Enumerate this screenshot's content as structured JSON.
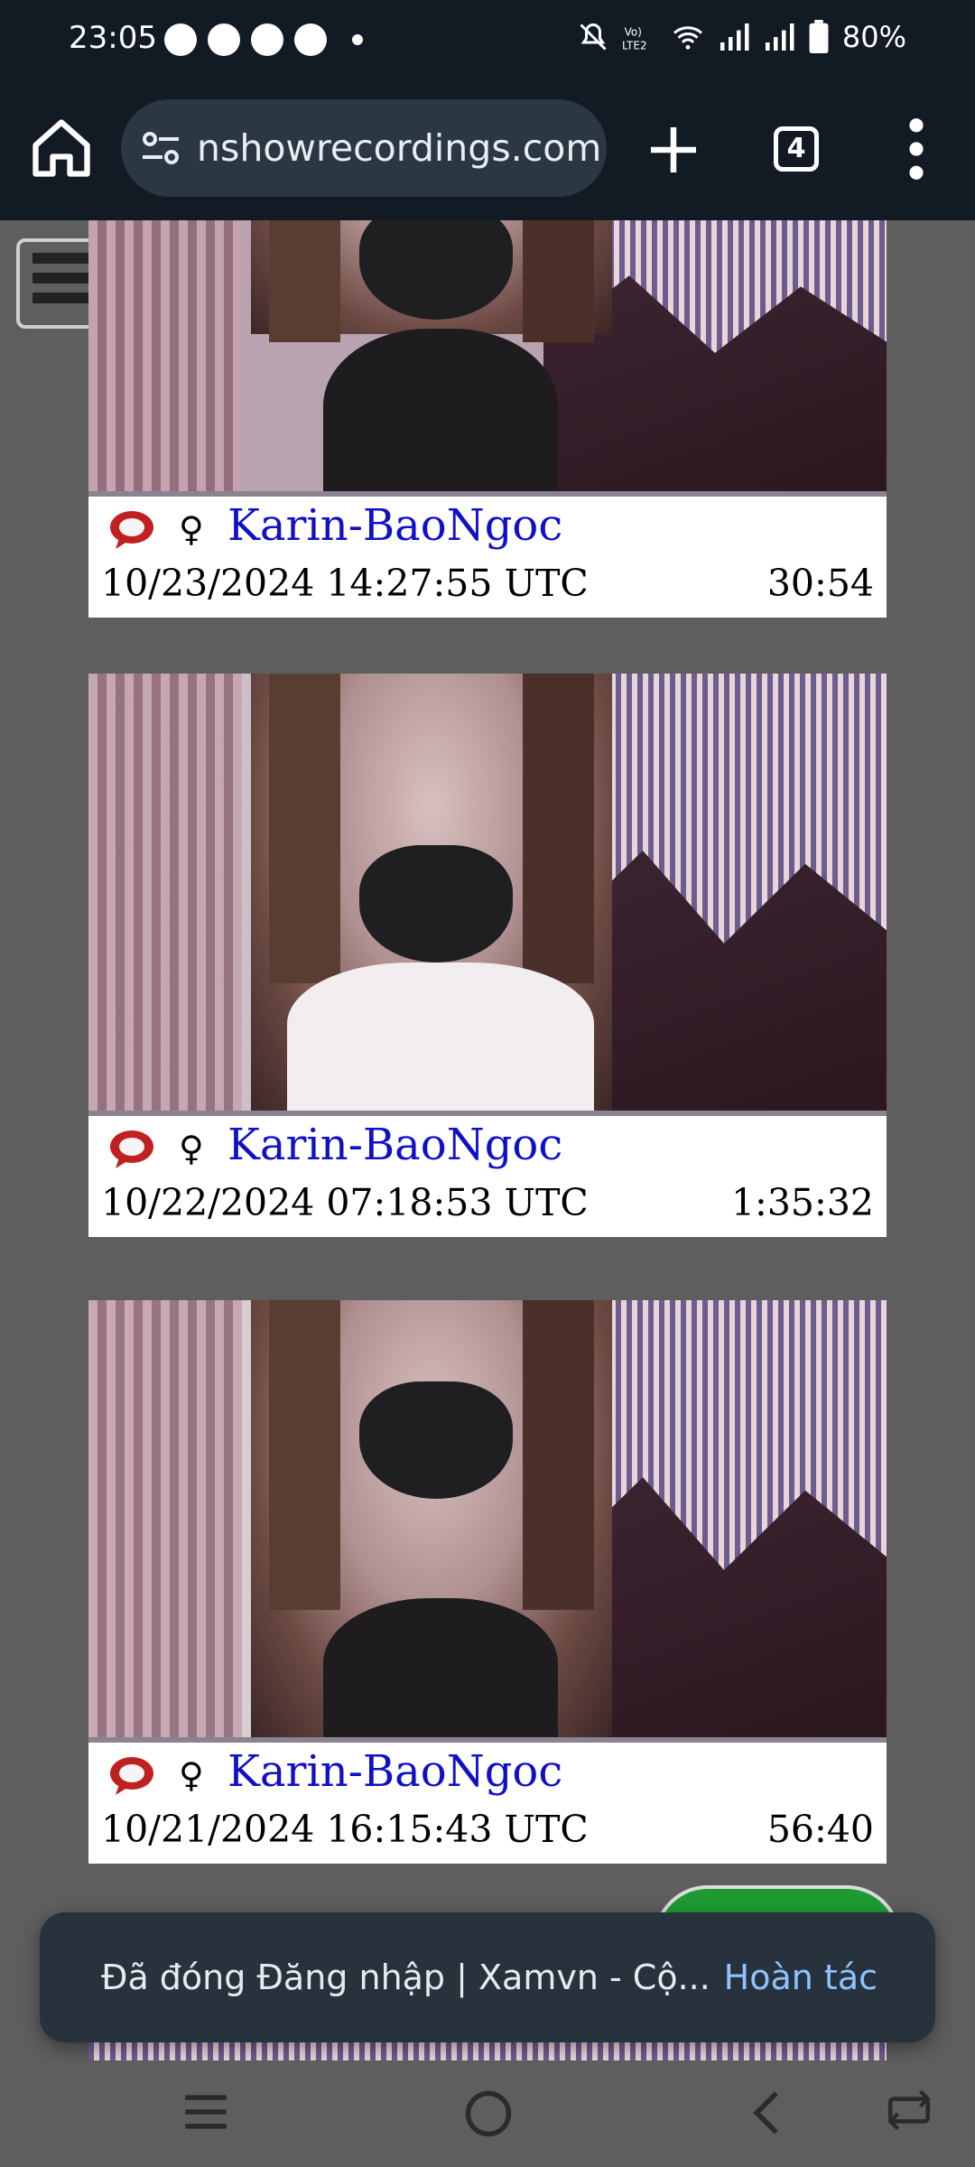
{
  "status_bar": {
    "time": "23:05",
    "battery": "80%",
    "left_icons": [
      "chat-bubble-icon",
      "messenger-icon",
      "app-icon",
      "app-icon",
      "dot-icon"
    ],
    "right_icons": [
      "mute-icon",
      "volte-icon",
      "wifi-icon",
      "signal-icon",
      "signal-icon",
      "battery-icon"
    ]
  },
  "browser": {
    "url": "nshowrecordings.com",
    "tab_count": "4"
  },
  "recordings": [
    {
      "name": "Karin-BaoNgoc",
      "gender": "♀",
      "datetime": "10/23/2024 14:27:55 UTC",
      "duration": "30:54"
    },
    {
      "name": "Karin-BaoNgoc",
      "gender": "♀",
      "datetime": "10/22/2024 07:18:53 UTC",
      "duration": "1:35:32"
    },
    {
      "name": "Karin-BaoNgoc",
      "gender": "♀",
      "datetime": "10/21/2024 16:15:43 UTC",
      "duration": "56:40"
    }
  ],
  "toast": {
    "message": "Đã đóng Đăng nhập | Xamvn - Cộ...",
    "action": "Hoàn tác"
  },
  "colors": {
    "browser_bar": "#121a24",
    "page_bg": "#5e5e5e",
    "name_link": "#1010c8",
    "toast_bg": "#28323d",
    "toast_action": "#8ec3ff",
    "fab": "#1f9a32"
  }
}
